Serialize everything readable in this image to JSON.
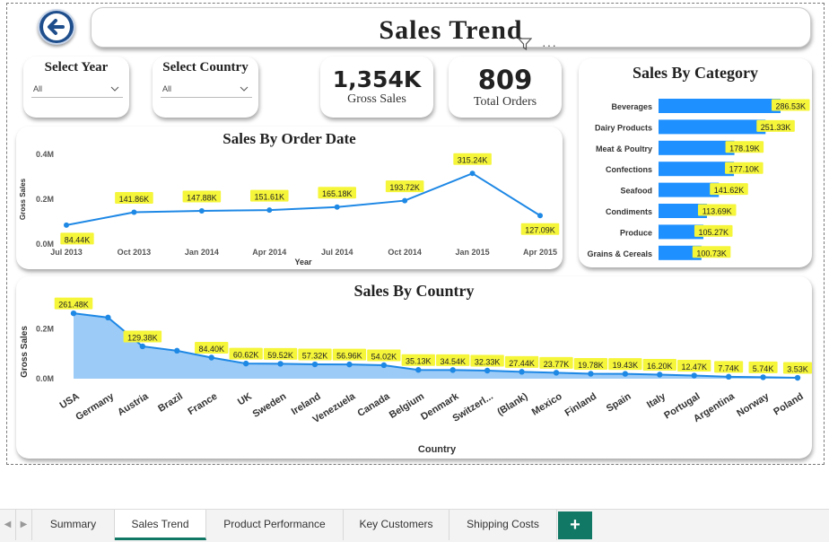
{
  "page": {
    "title": "Sales Trend"
  },
  "filters": {
    "year": {
      "label": "Select Year",
      "value": "All"
    },
    "country": {
      "label": "Select Country",
      "value": "All"
    }
  },
  "kpis": {
    "gross_sales": {
      "value": "1,354K",
      "label": "Gross Sales"
    },
    "total_orders": {
      "value": "809",
      "label": "Total Orders"
    }
  },
  "tabs": [
    "Summary",
    "Sales Trend",
    "Product Performance",
    "Key Customers",
    "Shipping Costs"
  ],
  "active_tab": "Sales Trend",
  "add_tab_label": "+",
  "colors": {
    "bar": "#1e90ff",
    "line": "#1e88e5",
    "area": "#9ccbf7",
    "label_bg": "#f5f53a",
    "tab_accent": "#117865"
  },
  "chart_data": [
    {
      "id": "order_date",
      "type": "line",
      "title": "Sales By Order Date",
      "xlabel": "Year",
      "ylabel": "Gross Sales",
      "yticks": [
        "0.0M",
        "0.2M",
        "0.4M"
      ],
      "ylim": [
        0,
        400
      ],
      "x": [
        "Jul 2013",
        "Oct 2013",
        "Jan 2014",
        "Apr 2014",
        "Jul 2014",
        "Oct 2014",
        "Jan 2015",
        "Apr 2015"
      ],
      "values": [
        84.44,
        141.86,
        147.88,
        151.61,
        165.18,
        193.72,
        315.24,
        127.09
      ],
      "labels": [
        "84.44K",
        "141.86K",
        "147.88K",
        "151.61K",
        "165.18K",
        "193.72K",
        "315.24K",
        "127.09K"
      ]
    },
    {
      "id": "category",
      "type": "bar",
      "orientation": "horizontal",
      "title": "Sales By Category",
      "categories": [
        "Beverages",
        "Dairy Products",
        "Meat & Poultry",
        "Confections",
        "Seafood",
        "Condiments",
        "Produce",
        "Grains & Cereals"
      ],
      "values": [
        286.53,
        251.33,
        178.19,
        177.1,
        141.62,
        113.69,
        105.27,
        100.73
      ],
      "labels": [
        "286.53K",
        "251.33K",
        "178.19K",
        "177.10K",
        "141.62K",
        "113.69K",
        "105.27K",
        "100.73K"
      ]
    },
    {
      "id": "country",
      "type": "area",
      "title": "Sales By Country",
      "xlabel": "Country",
      "ylabel": "Gross Sales",
      "yticks": [
        "0.0M",
        "0.2M"
      ],
      "ylim": [
        0,
        280
      ],
      "categories": [
        "USA",
        "Germany",
        "Austria",
        "Brazil",
        "France",
        "UK",
        "Sweden",
        "Ireland",
        "Venezuela",
        "Canada",
        "Belgium",
        "Denmark",
        "Switzerl...",
        "(Blank)",
        "Mexico",
        "Finland",
        "Spain",
        "Italy",
        "Portugal",
        "Argentina",
        "Norway",
        "Poland"
      ],
      "values": [
        261.48,
        244.64,
        129.38,
        111.85,
        84.4,
        60.62,
        59.52,
        57.32,
        56.96,
        54.02,
        35.13,
        34.54,
        32.33,
        27.44,
        23.77,
        19.78,
        19.43,
        16.2,
        12.47,
        7.74,
        5.74,
        3.53
      ],
      "labels": [
        "261.48K",
        "",
        "129.38K",
        "",
        "84.40K",
        "60.62K",
        "59.52K",
        "57.32K",
        "56.96K",
        "54.02K",
        "35.13K",
        "34.54K",
        "32.33K",
        "27.44K",
        "23.77K",
        "19.78K",
        "19.43K",
        "16.20K",
        "12.47K",
        "7.74K",
        "5.74K",
        "3.53K"
      ]
    }
  ]
}
